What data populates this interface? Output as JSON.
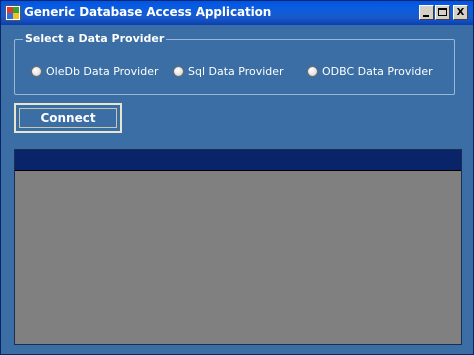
{
  "window": {
    "title": "Generic Database Access Application",
    "icon": "app-window-icon",
    "controls": {
      "minimize_icon": "minimize-icon",
      "maximize_icon": "maximize-icon",
      "close_glyph": "X"
    }
  },
  "provider_group": {
    "legend": "Select a Data Provider",
    "options": [
      {
        "label": "OleDb Data Provider",
        "selected": false
      },
      {
        "label": "Sql Data Provider",
        "selected": false
      },
      {
        "label": "ODBC Data Provider",
        "selected": false
      }
    ]
  },
  "connect_button": {
    "label": "Connect"
  },
  "colors": {
    "form_background": "#3a6ea5",
    "grid_background": "#808080",
    "grid_header": "#0a246a"
  }
}
